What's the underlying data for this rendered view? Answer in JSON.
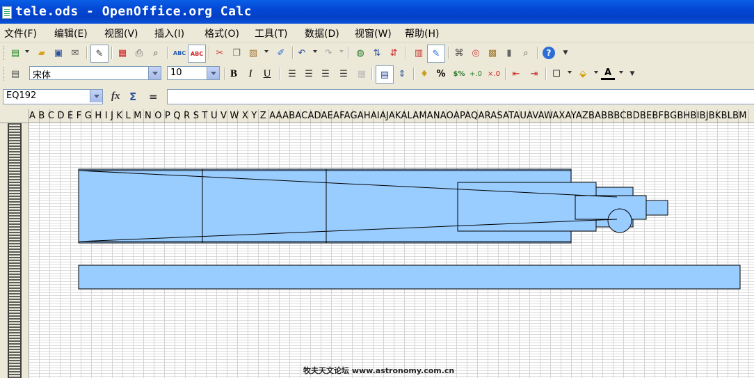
{
  "window": {
    "title": "tele.ods - OpenOffice.org Calc"
  },
  "menu": {
    "items": [
      "文件(F)",
      "编辑(E)",
      "视图(V)",
      "插入(I)",
      "格式(O)",
      "工具(T)",
      "数据(D)",
      "视窗(W)",
      "帮助(H)"
    ]
  },
  "toolbar": {
    "font_name": "宋体",
    "font_size": "10",
    "bold_label": "B",
    "italic_label": "I",
    "underline_label": "U",
    "percent_label": "%"
  },
  "formula_bar": {
    "name_box": "EQ192",
    "function_icon": "fx",
    "sum_icon": "Σ",
    "equals_icon": "=",
    "formula": ""
  },
  "sheet": {
    "column_headers": "A B C D E F G H I J K L M N O P Q R S T U V W X Y Z AAABACADAEAFAGAHAIAJAKALAMANAOAPAQARASATAUAVAWAXAYAZBABBBCBDBEBFBGBHBIBJBKBLBM"
  },
  "colors": {
    "shape_fill": "#99ccff",
    "shape_stroke": "#000000",
    "titlebar": "#0447d4"
  },
  "watermark": "牧夫天文论坛 www.astronomy.com.cn"
}
